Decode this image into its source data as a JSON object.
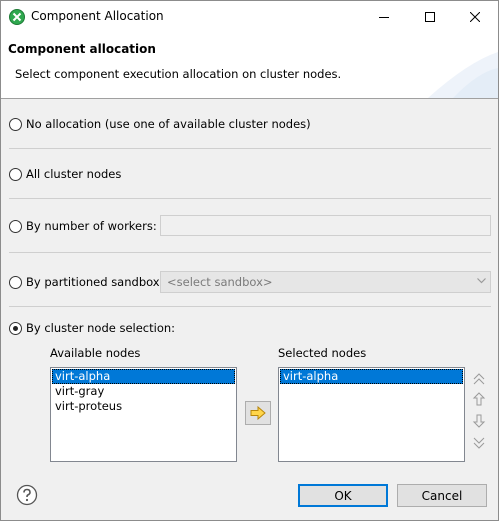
{
  "window": {
    "title": "Component Allocation"
  },
  "banner": {
    "title": "Component allocation",
    "description": "Select component execution allocation on cluster nodes."
  },
  "options": {
    "no_allocation": "No allocation (use one of available cluster nodes)",
    "all_nodes": "All cluster nodes",
    "by_workers": "By number of workers:",
    "by_sandbox": "By partitioned sandbox:",
    "by_selection": "By cluster node selection:",
    "selected_option": "by_selection"
  },
  "workers_field": {
    "value": ""
  },
  "sandbox_combo": {
    "value": "<select sandbox>"
  },
  "available_nodes": {
    "label": "Available nodes",
    "items": [
      "virt-alpha",
      "virt-gray",
      "virt-proteus"
    ],
    "selected": "virt-alpha"
  },
  "selected_nodes": {
    "label": "Selected nodes",
    "items": [
      "virt-alpha"
    ],
    "selected": "virt-alpha"
  },
  "icons": {
    "app": "cluster-allocation-icon",
    "move": "arrow-right-icon",
    "order": [
      "move-top-icon",
      "move-up-icon",
      "move-down-icon",
      "move-bottom-icon"
    ],
    "help": "help-icon"
  },
  "buttons": {
    "ok": "OK",
    "cancel": "Cancel"
  },
  "colors": {
    "selection": "#0078d7",
    "app_icon": "#2fa84f"
  }
}
